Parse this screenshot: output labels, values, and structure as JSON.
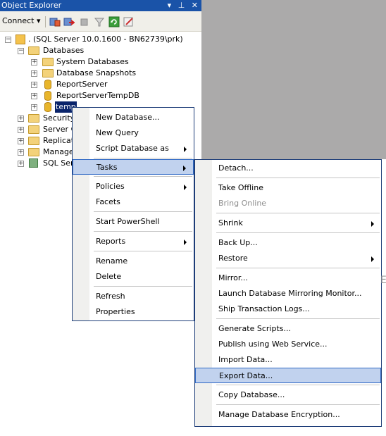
{
  "panel": {
    "title": "Object Explorer",
    "title_controls": "▾ ⁠▯ ✕",
    "connect_label": "Connect ▾"
  },
  "tree": {
    "server": ". (SQL Server 10.0.1600 - BN62739\\prk)",
    "databases": "Databases",
    "system_databases": "System Databases",
    "database_snapshots": "Database Snapshots",
    "report_server": "ReportServer",
    "report_server_temp": "ReportServerTempDB",
    "temp": "temp",
    "security": "Security",
    "server_objects": "Server O",
    "replication": "Replicati",
    "management": "Manager",
    "sql_agent": "SQL Serv"
  },
  "context_menu": {
    "items": [
      {
        "label": "New Database...",
        "submenu": false
      },
      {
        "label": "New Query",
        "submenu": false
      },
      {
        "label": "Script Database as",
        "submenu": true
      },
      {
        "label": "Tasks",
        "submenu": true,
        "highlighted": true
      },
      {
        "label": "Policies",
        "submenu": true
      },
      {
        "label": "Facets",
        "submenu": false
      },
      {
        "label": "Start PowerShell",
        "submenu": false
      },
      {
        "label": "Reports",
        "submenu": true
      },
      {
        "label": "Rename",
        "submenu": false
      },
      {
        "label": "Delete",
        "submenu": false
      },
      {
        "label": "Refresh",
        "submenu": false
      },
      {
        "label": "Properties",
        "submenu": false
      }
    ]
  },
  "tasks_menu": {
    "items": [
      {
        "label": "Detach...",
        "submenu": false
      },
      {
        "label": "Take Offline",
        "submenu": false
      },
      {
        "label": "Bring Online",
        "submenu": false,
        "disabled": true
      },
      {
        "label": "Shrink",
        "submenu": true
      },
      {
        "label": "Back Up...",
        "submenu": false
      },
      {
        "label": "Restore",
        "submenu": true
      },
      {
        "label": "Mirror...",
        "submenu": false
      },
      {
        "label": "Launch Database Mirroring Monitor...",
        "submenu": false
      },
      {
        "label": "Ship Transaction Logs...",
        "submenu": false
      },
      {
        "label": "Generate Scripts...",
        "submenu": false
      },
      {
        "label": "Publish using Web Service...",
        "submenu": false
      },
      {
        "label": "Import Data...",
        "submenu": false
      },
      {
        "label": "Export Data...",
        "submenu": false,
        "highlighted": true
      },
      {
        "label": "Copy Database...",
        "submenu": false
      },
      {
        "label": "Manage Database Encryption...",
        "submenu": false
      }
    ]
  },
  "edge_text": "E",
  "colors": {
    "titlebar": "#1a53a8",
    "menu_highlight": "#c1d2ee",
    "menu_highlight_border": "#316ac5",
    "selection": "#0a246a",
    "grey_area": "#abaaaa"
  }
}
